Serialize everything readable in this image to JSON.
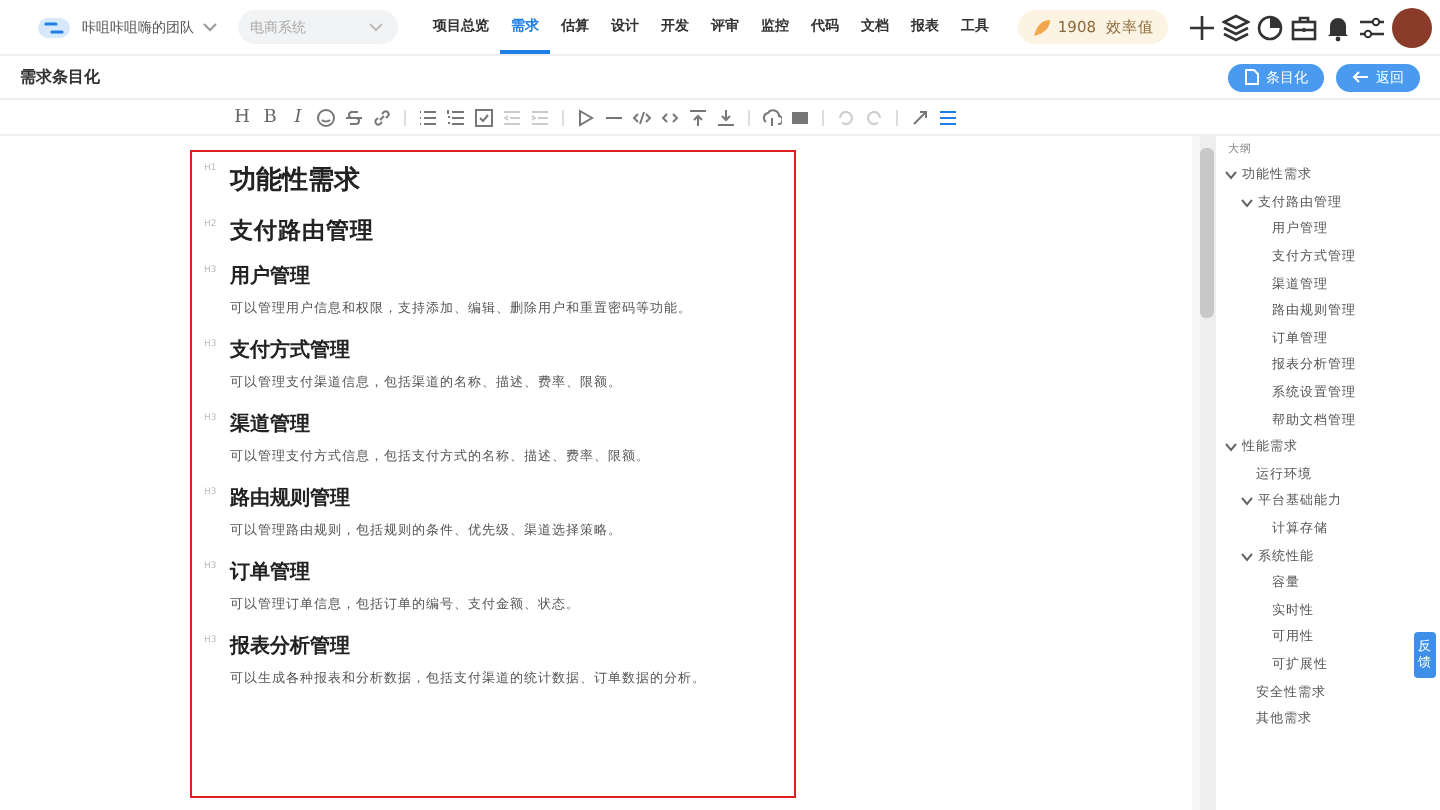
{
  "topbar": {
    "team": "咔咀咔咀嗨的团队",
    "project": {
      "placeholder": "电商系统"
    },
    "nav": [
      {
        "label": "项目总览",
        "selected": false
      },
      {
        "label": "需求",
        "selected": true
      },
      {
        "label": "估算",
        "selected": false
      },
      {
        "label": "设计",
        "selected": false
      },
      {
        "label": "开发",
        "selected": false
      },
      {
        "label": "评审",
        "selected": false
      },
      {
        "label": "监控",
        "selected": false
      },
      {
        "label": "代码",
        "selected": false
      },
      {
        "label": "文档",
        "selected": false
      },
      {
        "label": "报表",
        "selected": false
      },
      {
        "label": "工具",
        "selected": false
      }
    ],
    "score": {
      "value": "1908",
      "label": "效率值"
    }
  },
  "page": {
    "title": "需求条目化",
    "buttons": [
      {
        "kind": "itemize",
        "label": "条目化"
      },
      {
        "kind": "back",
        "label": "返回"
      }
    ]
  },
  "toolbar": {
    "text_buttons": [
      "H",
      "B",
      "I"
    ]
  },
  "document": [
    {
      "kind": "h1",
      "mark": "H1",
      "text": "功能性需求"
    },
    {
      "kind": "h2",
      "mark": "H2",
      "text": "支付路由管理"
    },
    {
      "kind": "h3",
      "mark": "H3",
      "text": "用户管理"
    },
    {
      "kind": "p",
      "text": "可以管理用户信息和权限，支持添加、编辑、删除用户和重置密码等功能。"
    },
    {
      "kind": "h3",
      "mark": "H3",
      "text": "支付方式管理"
    },
    {
      "kind": "p",
      "text": "可以管理支付渠道信息，包括渠道的名称、描述、费率、限额。"
    },
    {
      "kind": "h3",
      "mark": "H3",
      "text": "渠道管理"
    },
    {
      "kind": "p",
      "text": "可以管理支付方式信息，包括支付方式的名称、描述、费率、限额。"
    },
    {
      "kind": "h3",
      "mark": "H3",
      "text": "路由规则管理"
    },
    {
      "kind": "p",
      "text": "可以管理路由规则，包括规则的条件、优先级、渠道选择策略。"
    },
    {
      "kind": "h3",
      "mark": "H3",
      "text": "订单管理"
    },
    {
      "kind": "p",
      "text": "可以管理订单信息，包括订单的编号、支付金额、状态。"
    },
    {
      "kind": "h3",
      "mark": "H3",
      "text": "报表分析管理"
    },
    {
      "kind": "p",
      "text": "可以生成各种报表和分析数据，包括支付渠道的统计数据、订单数据的分析。"
    }
  ],
  "outline": {
    "title": "大纲",
    "items": [
      {
        "label": "功能性需求",
        "expanded": true,
        "children": [
          {
            "label": "支付路由管理",
            "expanded": true,
            "children": [
              {
                "label": "用户管理"
              },
              {
                "label": "支付方式管理"
              },
              {
                "label": "渠道管理"
              },
              {
                "label": "路由规则管理"
              },
              {
                "label": "订单管理"
              },
              {
                "label": "报表分析管理"
              },
              {
                "label": "系统设置管理"
              },
              {
                "label": "帮助文档管理"
              }
            ]
          }
        ]
      },
      {
        "label": "性能需求",
        "expanded": true,
        "children": [
          {
            "label": "运行环境"
          },
          {
            "label": "平台基础能力",
            "expanded": true,
            "children": [
              {
                "label": "计算存储"
              }
            ]
          },
          {
            "label": "系统性能",
            "expanded": true,
            "children": [
              {
                "label": "容量"
              },
              {
                "label": "实时性"
              },
              {
                "label": "可用性"
              },
              {
                "label": "可扩展性"
              }
            ]
          },
          {
            "label": "安全性需求"
          },
          {
            "label": "其他需求"
          }
        ]
      }
    ]
  },
  "feedback": "反馈"
}
